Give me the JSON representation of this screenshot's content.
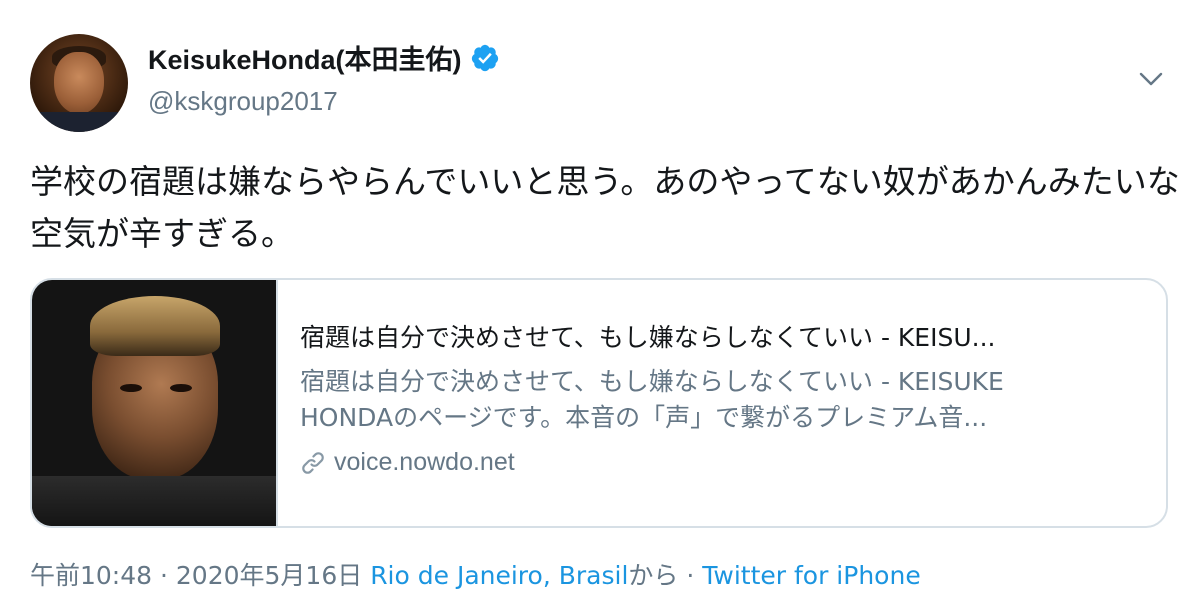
{
  "author": {
    "display_name": "KeisukeHonda(本田圭佑)",
    "handle": "@kskgroup2017",
    "verified": true
  },
  "tweet": {
    "text": "学校の宿題は嫌ならやらんでいいと思う。あのやってない奴があかんみたいな空気が辛すぎる。"
  },
  "card": {
    "title": "宿題は自分で決めさせて、もし嫌ならしなくていい - KEISU...",
    "description_line1": "宿題は自分で決めさせて、もし嫌ならしなくていい - KEISUKE",
    "description_line2": "HONDAのページです。本音の「声」で繋がるプレミアム音...",
    "domain": "voice.nowdo.net"
  },
  "meta": {
    "time_date": "午前10:48 · 2020年5月16日",
    "location": "Rio de Janeiro, Brasil",
    "from_suffix": "から",
    "separator": " · ",
    "source": "Twitter for iPhone"
  },
  "colors": {
    "verified_badge": "#1da1f2",
    "link": "#1b95e0",
    "secondary_text": "#657786",
    "border": "#d6dfe6"
  },
  "icons": {
    "verified": "verified-badge-icon",
    "menu": "chevron-down-icon",
    "link": "link-icon"
  }
}
